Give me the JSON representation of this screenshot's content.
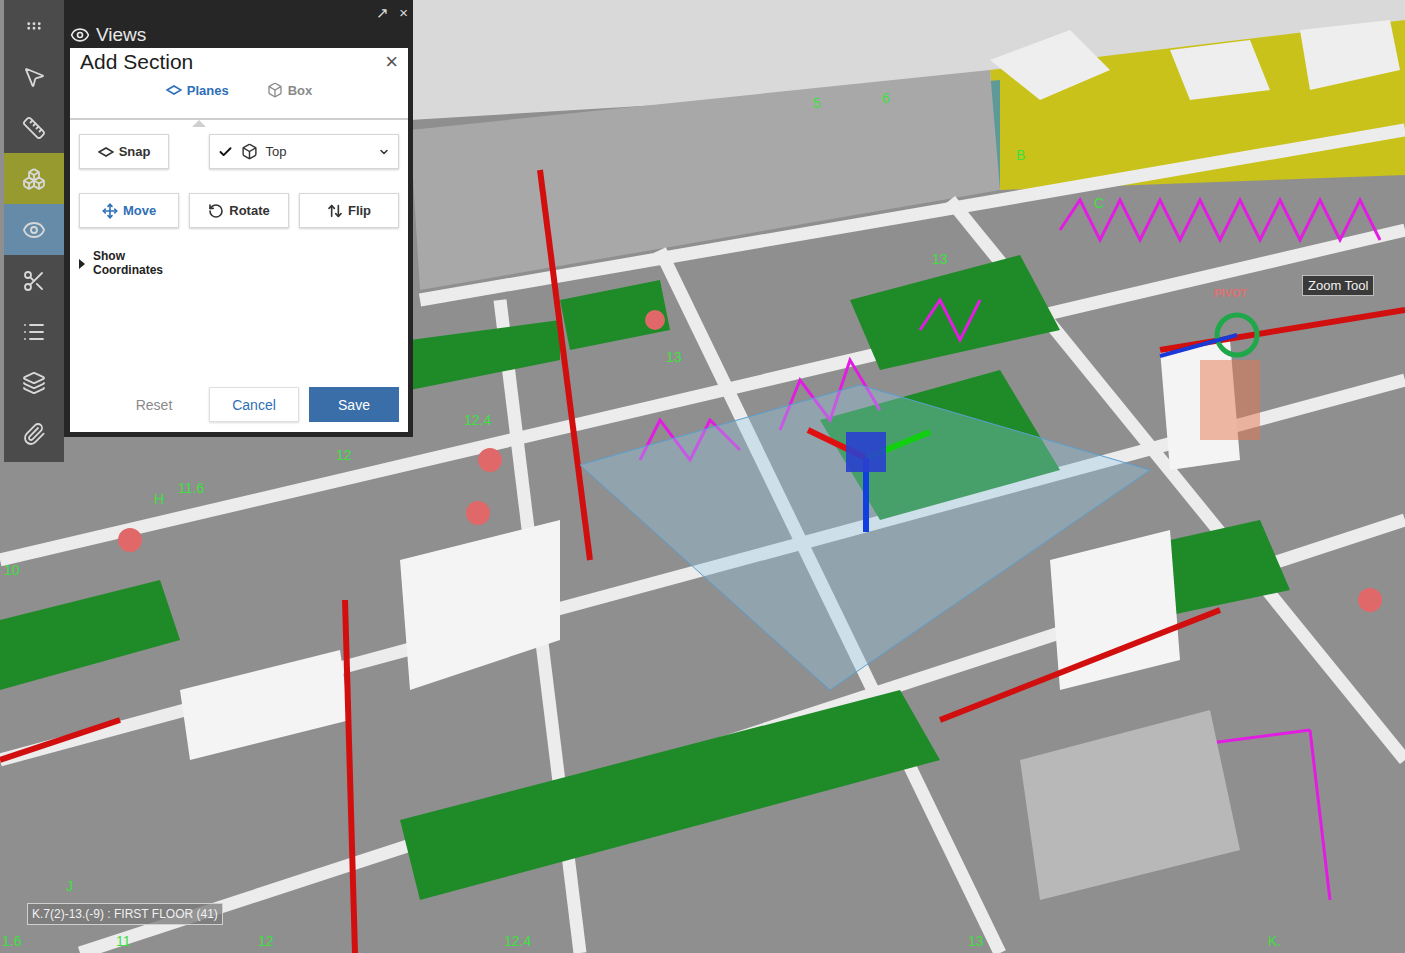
{
  "panel": {
    "title": "Views",
    "popout": "↗",
    "close": "×"
  },
  "toolbar": [
    {
      "selected": false
    },
    {
      "selected": false
    },
    {
      "selected": false
    },
    {
      "selected": false
    },
    {
      "selected": true
    },
    {
      "selected": false
    },
    {
      "selected": false
    },
    {
      "selected": false
    },
    {
      "selected": false
    }
  ],
  "dialog": {
    "title": "Add Section",
    "close": "×",
    "tabs": [
      {
        "label": "Planes",
        "selected": true
      },
      {
        "label": "Box",
        "selected": false
      }
    ],
    "snap": "Snap",
    "plane": {
      "checked": true,
      "label": "Top"
    },
    "actions": [
      {
        "label": "Move",
        "selected": true
      },
      {
        "label": "Rotate",
        "selected": false
      },
      {
        "label": "Flip",
        "selected": false
      }
    ],
    "coordinates": {
      "label": "Show Coordinates",
      "expanded": false
    },
    "footer": [
      {
        "label": "Reset",
        "kind": "disabled"
      },
      {
        "label": "Cancel",
        "kind": "secondary"
      },
      {
        "label": "Save",
        "kind": "primary"
      }
    ]
  },
  "viewport": {
    "pivot": "PIVOT",
    "tooltip": "Zoom Tool",
    "location": "K.7(2)-13.(-9) : FIRST FLOOR (41)",
    "grid_labels": [
      "1.6",
      "11",
      "12",
      "12.4",
      "13",
      "K.",
      "10",
      "J",
      "H",
      "11.6",
      "12",
      "12.4",
      "13",
      "5",
      "6",
      "13",
      "B",
      "C"
    ]
  }
}
